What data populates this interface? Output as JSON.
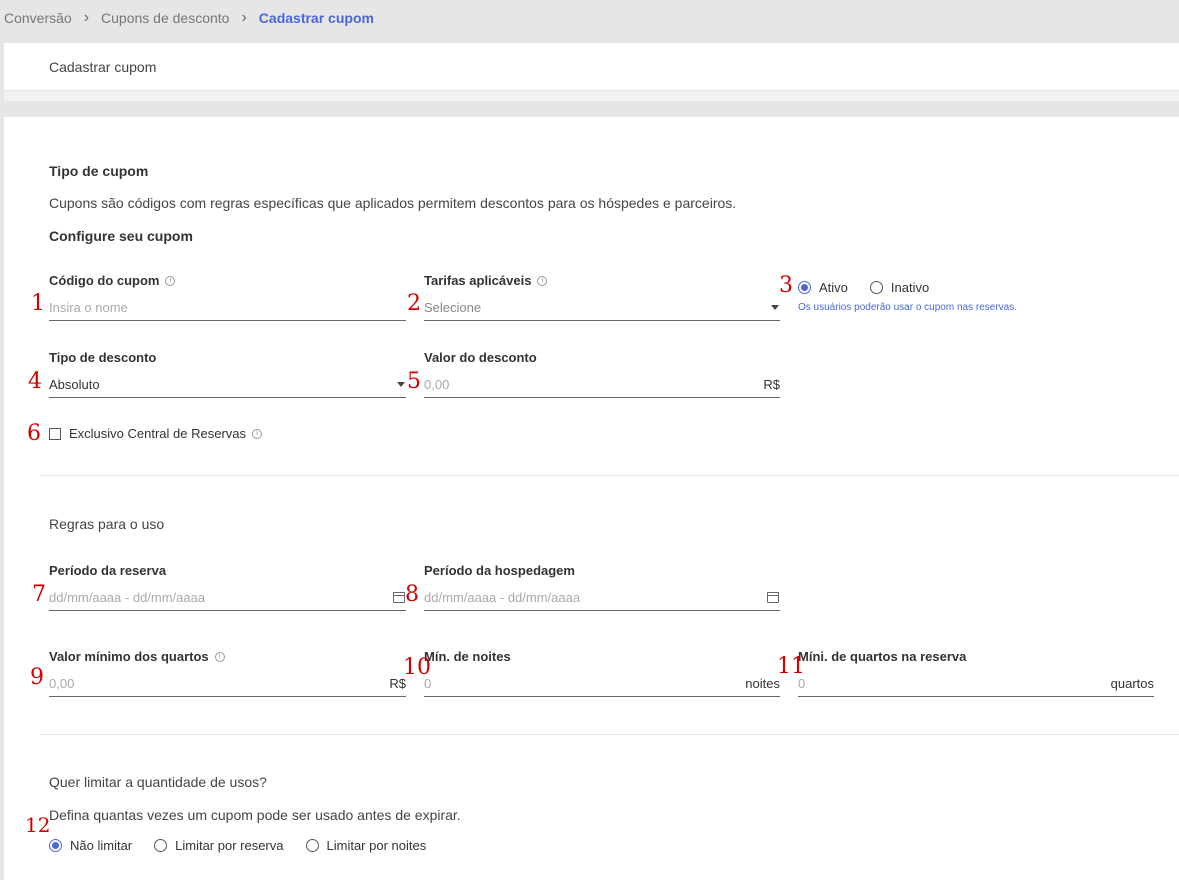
{
  "breadcrumb": {
    "items": [
      "Conversão",
      "Cupons de desconto"
    ],
    "current": "Cadastrar cupom"
  },
  "header": {
    "title": "Cadastrar cupom"
  },
  "tipo": {
    "title": "Tipo de cupom",
    "description": "Cupons são códigos com regras específicas que aplicados permitem descontos para os hóspedes e parceiros.",
    "subtitle": "Configure seu cupom"
  },
  "fields": {
    "codigo": {
      "label": "Código do cupom",
      "placeholder": "Insira o nome"
    },
    "tarifas": {
      "label": "Tarifas aplicáveis",
      "placeholder": "Selecione"
    },
    "status": {
      "ativo": "Ativo",
      "inativo": "Inativo",
      "selected": "Ativo",
      "hint": "Os usuários poderão usar o cupom nas reservas."
    },
    "tipo_desconto": {
      "label": "Tipo de desconto",
      "value": "Absoluto"
    },
    "valor_desconto": {
      "label": "Valor do desconto",
      "placeholder": "0,00",
      "unit": "R$"
    },
    "exclusivo": {
      "label": "Exclusivo Central de Reservas",
      "checked": false
    }
  },
  "regras": {
    "title": "Regras para o uso",
    "periodo_reserva": {
      "label": "Período da reserva",
      "placeholder": "dd/mm/aaaa - dd/mm/aaaa"
    },
    "periodo_hospedagem": {
      "label": "Período da hospedagem",
      "placeholder": "dd/mm/aaaa - dd/mm/aaaa"
    },
    "valor_minimo": {
      "label": "Valor mínimo dos quartos",
      "placeholder": "0,00",
      "unit": "R$"
    },
    "min_noites": {
      "label": "Mín. de noites",
      "placeholder": "0",
      "unit": "noites"
    },
    "min_quartos": {
      "label": "Míni. de quartos na reserva",
      "placeholder": "0",
      "unit": "quartos"
    }
  },
  "limite": {
    "title": "Quer limitar a quantidade de usos?",
    "description": "Defina quantas vezes um cupom pode ser usado antes de expirar.",
    "options": [
      "Não limitar",
      "Limitar por reserva",
      "Limitar por noites"
    ],
    "selected": "Não limitar"
  },
  "markers": [
    "1",
    "2",
    "3",
    "4",
    "5",
    "6",
    "7",
    "8",
    "9",
    "10",
    "11",
    "12"
  ],
  "colors": {
    "accent": "#4a66d8",
    "marker": "#d40000"
  }
}
